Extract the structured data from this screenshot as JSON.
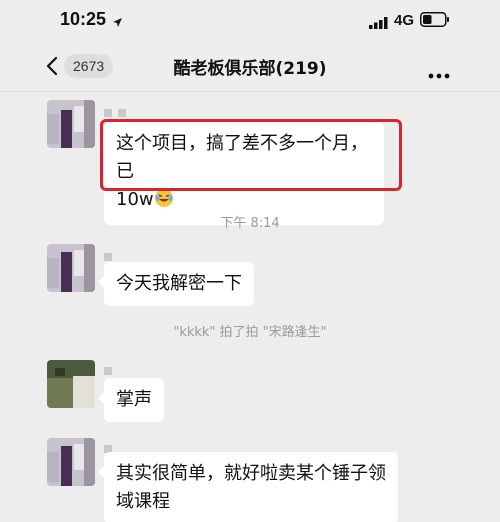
{
  "status": {
    "time": "10:25",
    "network": "4G"
  },
  "nav": {
    "back_count": "2673",
    "title": "酷老板俱乐部(219)"
  },
  "messages": [
    {
      "text_line1": "这个项目，搞了差不多一个月，已",
      "text_line2": "10w",
      "emoji": "face-with-tears-of-joy"
    },
    {
      "text": "今天我解密一下"
    },
    {
      "text": "掌声"
    },
    {
      "text_line1": "其实很简单，就好啦卖某个锤子领",
      "text_line2": "域课程"
    }
  ],
  "time_separator": "下午 8:14",
  "pat_notice": "\"kkkk\" 拍了拍 \"宋路逢生\"",
  "colors": {
    "highlight": "#d9232e",
    "background": "#ededed",
    "bubble": "#ffffff"
  }
}
